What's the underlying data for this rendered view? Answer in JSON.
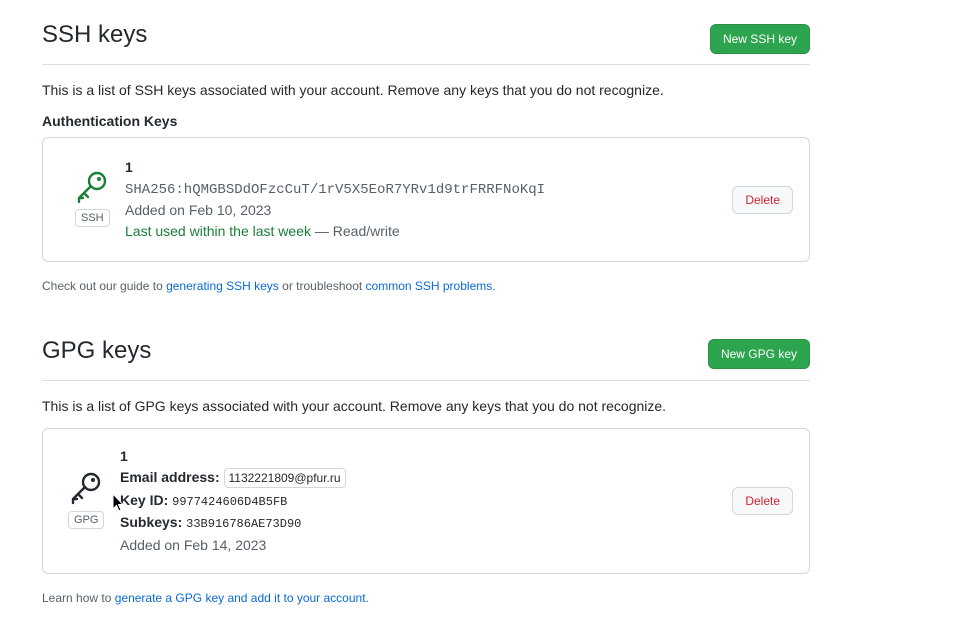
{
  "ssh": {
    "title": "SSH keys",
    "new_button": "New SSH key",
    "description": "This is a list of SSH keys associated with your account. Remove any keys that you do not recognize.",
    "subheading": "Authentication Keys",
    "key": {
      "icon": "key-icon",
      "icon_color": "#1a7f37",
      "badge": "SSH",
      "title": "1",
      "fingerprint": "SHA256:hQMGBSDdOFzcCuT/1rV5X5EoR7YRv1d9trFRRFNoKqI",
      "added": "Added on Feb 10, 2023",
      "last_used": "Last used within the last week",
      "access": " — Read/write",
      "delete_label": "Delete"
    },
    "footer": {
      "prefix": "Check out our guide to ",
      "link1": "generating SSH keys",
      "middle": " or troubleshoot ",
      "link2": "common SSH problems",
      "suffix": "."
    }
  },
  "gpg": {
    "title": "GPG keys",
    "new_button": "New GPG key",
    "description": "This is a list of GPG keys associated with your account. Remove any keys that you do not recognize.",
    "key": {
      "icon": "key-icon",
      "icon_color": "#24292f",
      "badge": "GPG",
      "title": "1",
      "email_label": "Email address:",
      "email_value": "1132221809@pfur.ru",
      "keyid_label": "Key ID:",
      "keyid_value": "9977424606D4B5FB",
      "subkeys_label": "Subkeys:",
      "subkeys_value": "33B916786AE73D90",
      "added": "Added on Feb 14, 2023",
      "delete_label": "Delete"
    },
    "footer": {
      "prefix": "Learn how to ",
      "link": "generate a GPG key and add it to your account",
      "suffix": "."
    }
  },
  "colors": {
    "primary_button": "#2da44e",
    "danger": "#cf222e",
    "link": "#0969da",
    "success": "#1a7f37"
  }
}
